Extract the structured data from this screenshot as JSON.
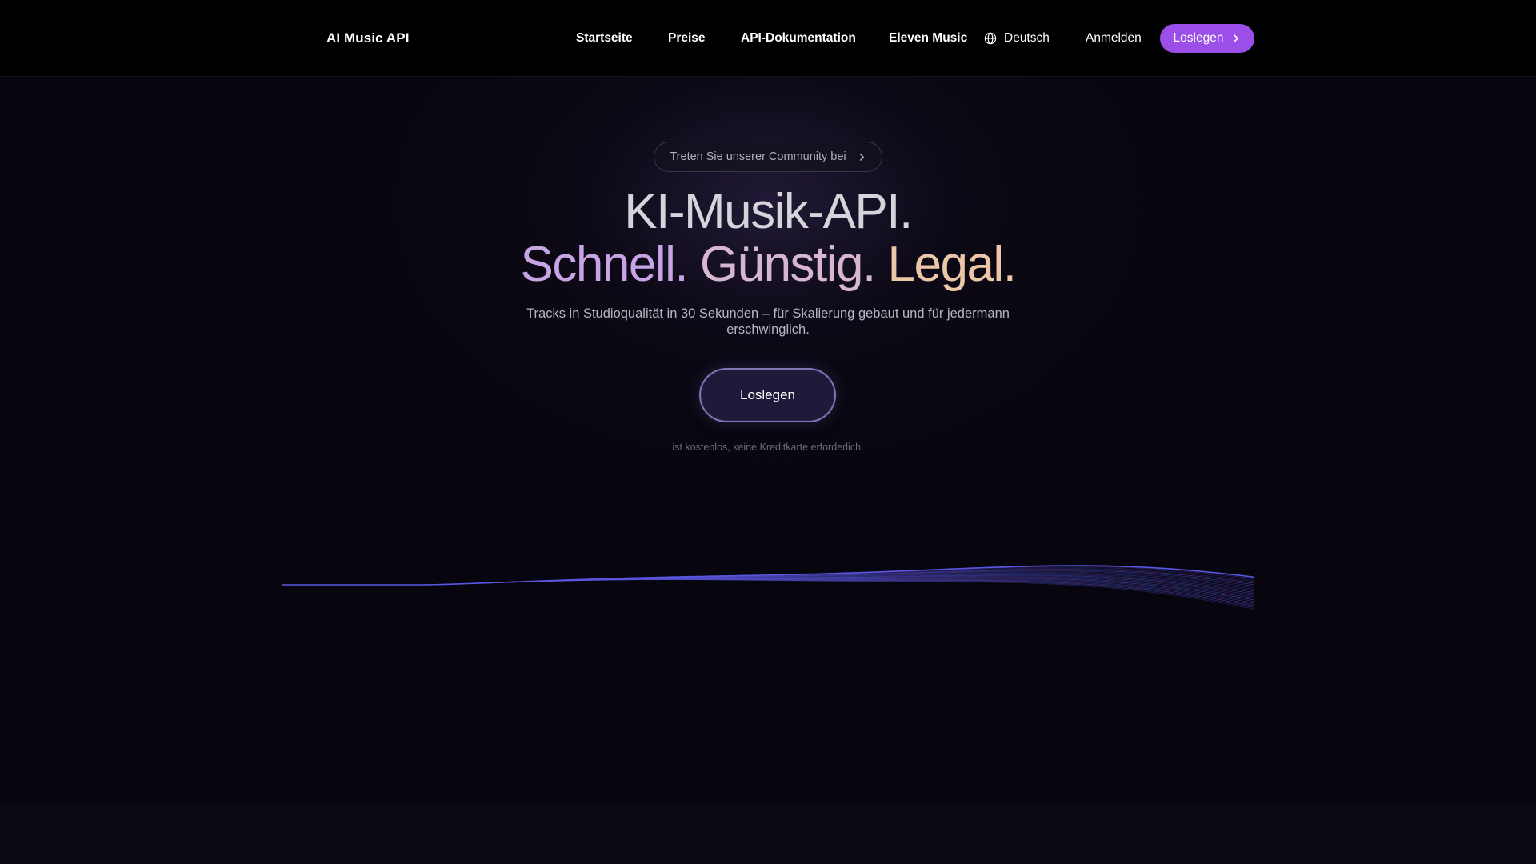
{
  "header": {
    "brand_name": "AI Music API",
    "brand_icon": "waveform-logo-icon",
    "nav": {
      "home": "Startseite",
      "pricing": "Preise",
      "docs": "API-Dokumentation",
      "eleven": "Eleven Music"
    },
    "language": {
      "label": "Deutsch",
      "icon": "globe-icon"
    },
    "login": "Anmelden",
    "cta": {
      "label": "Loslegen",
      "icon": "chevron-right-icon"
    }
  },
  "hero": {
    "community": {
      "label": "Treten Sie unserer Community bei",
      "icon": "chevron-right-icon"
    },
    "headline_line1": "KI-Musik-API.",
    "headline_line2": {
      "fast": "Schnell.",
      "cheap": "Günstig.",
      "legal": "Legal."
    },
    "subline": "Tracks in Studioqualität in 30 Sekunden – für Skalierung gebaut und für jedermann erschwinglich.",
    "cta": "Loslegen",
    "note": "ist kostenlos, keine Kreditkarte erforderlich."
  },
  "colors": {
    "accent": "#9b4fe8",
    "background": "#07050d",
    "header_bg": "#000000",
    "headline_schnell": "#c7a5e4",
    "headline_guenstig": "#d7b6cf",
    "headline_legal": "#ebc7a8"
  }
}
